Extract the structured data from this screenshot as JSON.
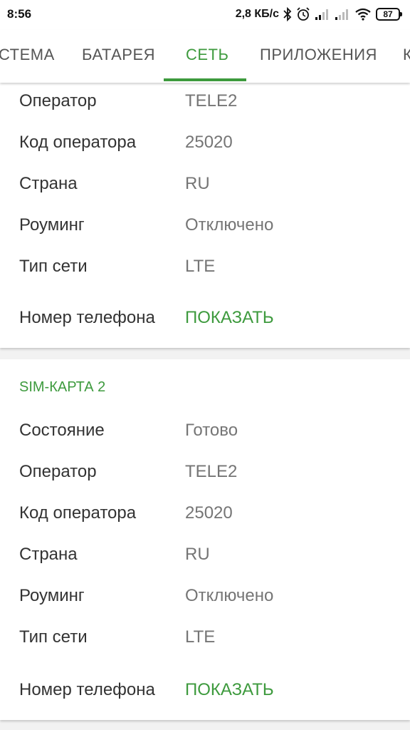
{
  "status_bar": {
    "time": "8:56",
    "network_speed": "2,8 КБ/с",
    "battery_level": "87",
    "icons": [
      "bluetooth-icon",
      "alarm-icon",
      "signal-1-icon",
      "signal-2-icon",
      "wifi-icon"
    ]
  },
  "tabs": {
    "items": [
      "СТЕМА",
      "БАТАРЕЯ",
      "СЕТЬ",
      "ПРИЛОЖЕНИЯ",
      "К"
    ],
    "active": "СЕТЬ"
  },
  "colors": {
    "accent": "#3d9a3d",
    "label": "#333333",
    "value": "#757575",
    "background": "#f2f2f2"
  },
  "sim1": {
    "rows": [
      {
        "label": "Оператор",
        "value": "TELE2"
      },
      {
        "label": "Код оператора",
        "value": "25020"
      },
      {
        "label": "Страна",
        "value": "RU"
      },
      {
        "label": "Роуминг",
        "value": "Отключено"
      },
      {
        "label": "Тип сети",
        "value": "LTE"
      }
    ],
    "phone": {
      "label": "Номер телефона",
      "action": "ПОКАЗАТЬ"
    }
  },
  "sim2": {
    "title": "SIM-КАРТА 2",
    "rows": [
      {
        "label": "Состояние",
        "value": "Готово"
      },
      {
        "label": "Оператор",
        "value": "TELE2"
      },
      {
        "label": "Код оператора",
        "value": "25020"
      },
      {
        "label": "Страна",
        "value": "RU"
      },
      {
        "label": "Роуминг",
        "value": "Отключено"
      },
      {
        "label": "Тип сети",
        "value": "LTE"
      }
    ],
    "phone": {
      "label": "Номер телефона",
      "action": "ПОКАЗАТЬ"
    }
  }
}
